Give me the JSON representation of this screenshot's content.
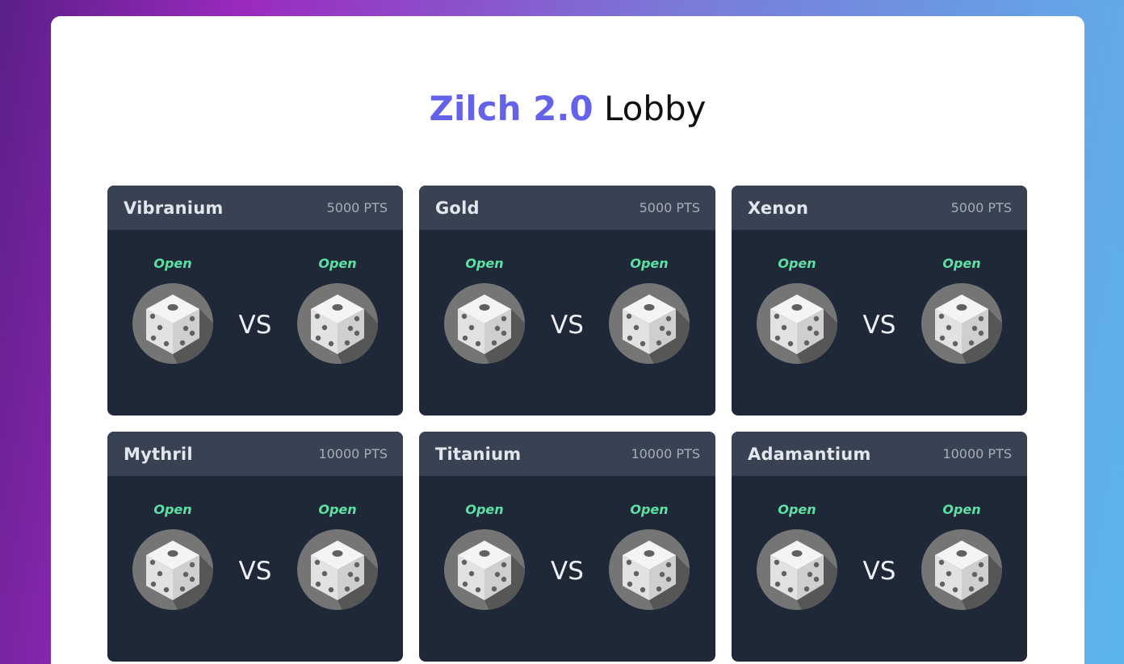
{
  "title": {
    "brand": "Zilch 2.0",
    "rest": " Lobby"
  },
  "vs_label": "VS",
  "rooms": [
    {
      "name": "Vibranium",
      "points": "5000 PTS",
      "seats": [
        {
          "status": "Open",
          "avatar": "dice-icon"
        },
        {
          "status": "Open",
          "avatar": "dice-icon"
        }
      ]
    },
    {
      "name": "Gold",
      "points": "5000 PTS",
      "seats": [
        {
          "status": "Open",
          "avatar": "dice-icon"
        },
        {
          "status": "Open",
          "avatar": "dice-icon"
        }
      ]
    },
    {
      "name": "Xenon",
      "points": "5000 PTS",
      "seats": [
        {
          "status": "Open",
          "avatar": "dice-icon"
        },
        {
          "status": "Open",
          "avatar": "dice-icon"
        }
      ]
    },
    {
      "name": "Mythril",
      "points": "10000 PTS",
      "seats": [
        {
          "status": "Open",
          "avatar": "dice-icon"
        },
        {
          "status": "Open",
          "avatar": "dice-icon"
        }
      ]
    },
    {
      "name": "Titanium",
      "points": "10000 PTS",
      "seats": [
        {
          "status": "Open",
          "avatar": "dice-icon"
        },
        {
          "status": "Open",
          "avatar": "dice-icon"
        }
      ]
    },
    {
      "name": "Adamantium",
      "points": "10000 PTS",
      "seats": [
        {
          "status": "Open",
          "avatar": "dice-icon"
        },
        {
          "status": "Open",
          "avatar": "dice-icon"
        }
      ]
    }
  ],
  "colors": {
    "brand": "#6462e8",
    "open_status": "#5ee0a4",
    "card_body": "#1f2837",
    "card_header": "#394253"
  }
}
